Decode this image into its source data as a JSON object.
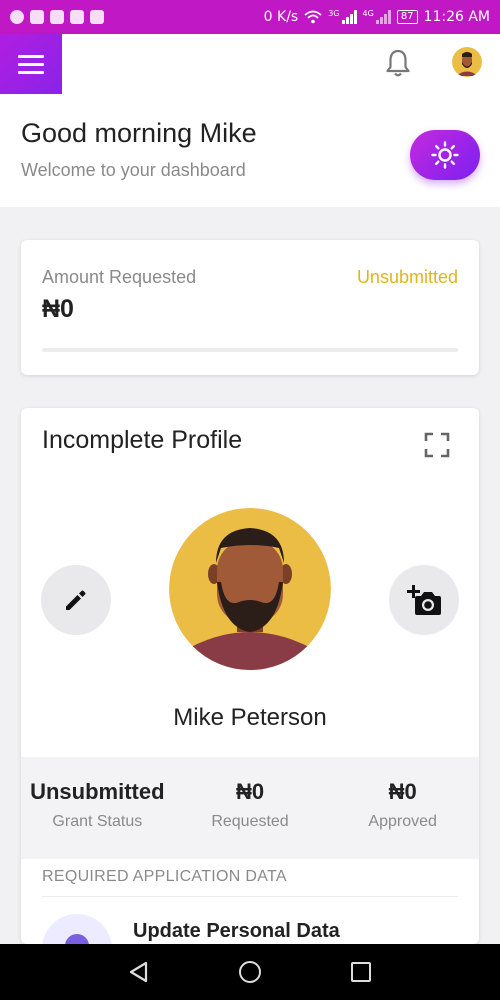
{
  "status_bar": {
    "speed": "0 K/s",
    "network_3g": "3G",
    "network_4g": "4G",
    "battery": "87",
    "time": "11:26 AM"
  },
  "app_bar": {
    "menu_icon": "menu-icon",
    "notification_icon": "bell-icon",
    "avatar_icon": "avatar"
  },
  "greeting": {
    "title": "Good morning Mike",
    "subtitle": "Welcome to your dashboard",
    "theme_icon": "sun-icon"
  },
  "amount_card": {
    "label": "Amount Requested",
    "status": "Unsubmitted",
    "value": "₦0",
    "progress": 0
  },
  "profile_card": {
    "title": "Incomplete Profile",
    "expand_icon": "expand-icon",
    "edit_icon": "pencil-icon",
    "camera_icon": "add-photo-icon",
    "name": "Mike Peterson",
    "stats": [
      {
        "value": "Unsubmitted",
        "label": "Grant Status"
      },
      {
        "value": "₦0",
        "label": "Requested"
      },
      {
        "value": "₦0",
        "label": "Approved"
      }
    ],
    "required_label": "REQUIRED APPLICATION DATA",
    "required_items": [
      {
        "title": "Update Personal Data"
      }
    ]
  },
  "colors": {
    "status_bar": "#c018c4",
    "accent_gradient_start": "#c42adf",
    "accent_gradient_end": "#7c1ff0",
    "warning": "#e3b51c",
    "avatar_bg": "#ebbd45"
  }
}
